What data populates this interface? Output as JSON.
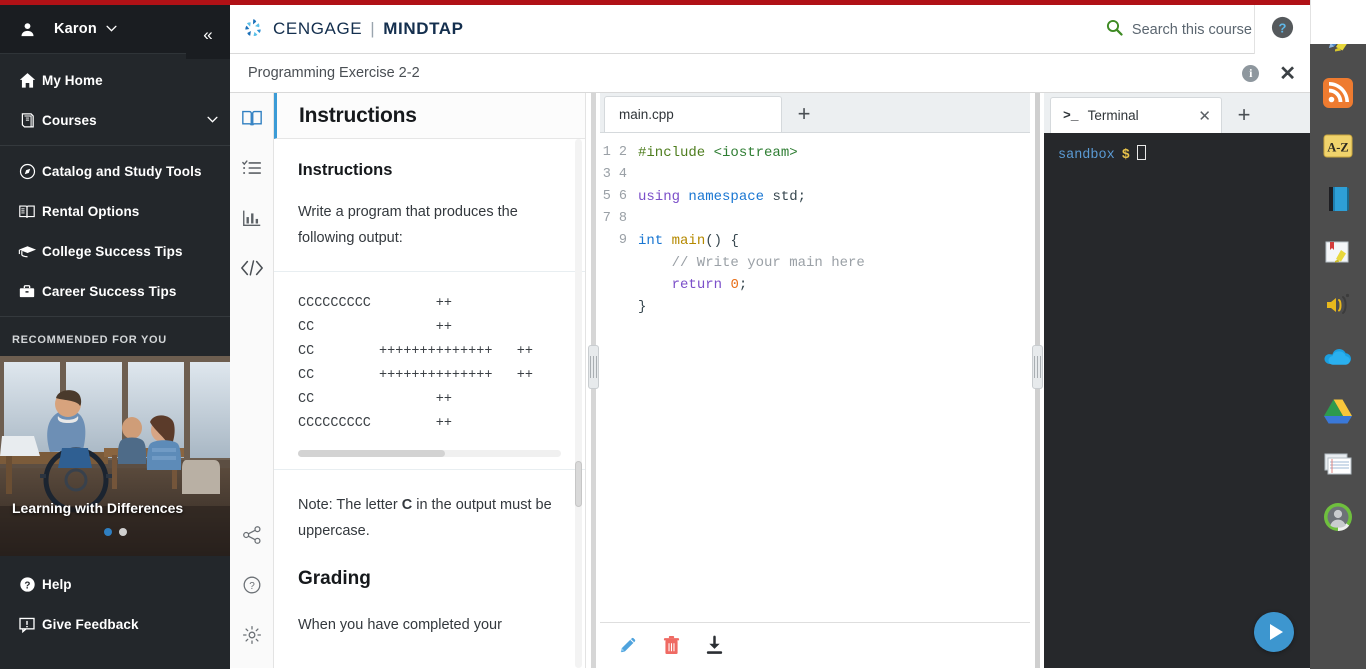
{
  "brand": {
    "accent_red": "#b01116",
    "logo_primary": "CENGAGE",
    "logo_secondary": "MINDTAP",
    "logo_divider": "|"
  },
  "sidebar": {
    "user": {
      "name": "Karon",
      "caret": "⌄",
      "icon": "user-icon"
    },
    "collapse_glyph": "«",
    "items": [
      {
        "label": "My Home",
        "icon": "home-icon"
      },
      {
        "label": "Courses",
        "icon": "book-stack-icon",
        "caret": "⌄"
      },
      {
        "label": "Catalog and Study Tools",
        "icon": "compass-icon"
      },
      {
        "label": "Rental Options",
        "icon": "open-book-icon"
      },
      {
        "label": "College Success Tips",
        "icon": "graduation-cap-icon"
      },
      {
        "label": "Career Success Tips",
        "icon": "briefcase-icon"
      }
    ],
    "recommended_title": "RECOMMENDED FOR YOU",
    "promo": {
      "caption": "Learning with Differences",
      "dots": 2,
      "active_dot": 0
    },
    "bottom_items": [
      {
        "label": "Help",
        "icon": "question-circle-icon"
      },
      {
        "label": "Give Feedback",
        "icon": "feedback-icon"
      }
    ]
  },
  "header": {
    "search_label": "Search this course",
    "search_icon": "search-icon",
    "help_icon": "help-circle-icon"
  },
  "activity": {
    "title": "Programming Exercise 2-2",
    "info_glyph": "i",
    "close_glyph": "✕"
  },
  "rail": {
    "top_icons": [
      "open-book-icon",
      "checklist-icon",
      "bar-chart-icon",
      "code-brackets-icon"
    ],
    "bottom_icons": [
      "share-icon",
      "help-circle-outline-icon",
      "gear-icon"
    ]
  },
  "instructions": {
    "panel_title": "Instructions",
    "section_heading": "Instructions",
    "intro": "Write a program that produces the following output:",
    "ascii_output": [
      "CCCCCCCCC        ++",
      "CC               ++",
      "CC        ++++++++++++++   ++",
      "CC        ++++++++++++++   ++",
      "CC               ++",
      "CCCCCCCCC        ++"
    ],
    "note_prefix": "Note: The letter ",
    "note_bold": "C",
    "note_suffix": " in the output must be uppercase.",
    "grading_heading": "Grading",
    "grading_text": "When you have completed your"
  },
  "editor": {
    "tabs": [
      {
        "label": "main.cpp",
        "active": true
      }
    ],
    "add_tab_glyph": "+",
    "line_numbers": [
      "1",
      "2",
      "3",
      "4",
      "5",
      "6",
      "7",
      "8",
      "9"
    ],
    "code_lines": [
      [
        {
          "t": "#include ",
          "c": "k-pre"
        },
        {
          "t": "<iostream>",
          "c": "k-inc"
        }
      ],
      [],
      [
        {
          "t": "using",
          "c": "k-kw"
        },
        {
          "t": " ",
          "c": "k-pl"
        },
        {
          "t": "namespace",
          "c": "k-ns"
        },
        {
          "t": " std;",
          "c": "k-pl"
        }
      ],
      [],
      [
        {
          "t": "int",
          "c": "k-ty"
        },
        {
          "t": " ",
          "c": "k-pl"
        },
        {
          "t": "main",
          "c": "k-fn"
        },
        {
          "t": "() {",
          "c": "k-pl"
        }
      ],
      [
        {
          "t": "    // Write your main here",
          "c": "k-cm"
        }
      ],
      [
        {
          "t": "    ",
          "c": "k-pl"
        },
        {
          "t": "return",
          "c": "k-kw"
        },
        {
          "t": " ",
          "c": "k-pl"
        },
        {
          "t": "0",
          "c": "k-num"
        },
        {
          "t": ";",
          "c": "k-pl"
        }
      ],
      [
        {
          "t": "}",
          "c": "k-pl"
        }
      ],
      []
    ],
    "footer_icons": [
      "pencil-icon",
      "trash-icon",
      "download-icon"
    ]
  },
  "terminal": {
    "tab_label": "Terminal",
    "tab_prompt_icon": ">_",
    "close_glyph": "✕",
    "add_tab_glyph": "+",
    "prompt_user": "sandbox",
    "prompt_symbol": "$",
    "run_button_icon": "play-icon"
  },
  "dock": {
    "icons": [
      "highlighter-pen-icon",
      "rss-feed-icon",
      "a-z-dictionary-icon",
      "blue-book-icon",
      "note-highlight-icon",
      "read-aloud-icon",
      "onedrive-cloud-icon",
      "google-drive-icon",
      "flashcards-icon",
      "profile-avatar-icon"
    ],
    "az_label": "A-Z"
  },
  "colors": {
    "sidebar_bg": "#23272b",
    "dock_bg": "#4d4d4d",
    "terminal_bg": "#26282b",
    "run_blue": "#3d96cf",
    "tab_accent": "#3b9bd6"
  }
}
